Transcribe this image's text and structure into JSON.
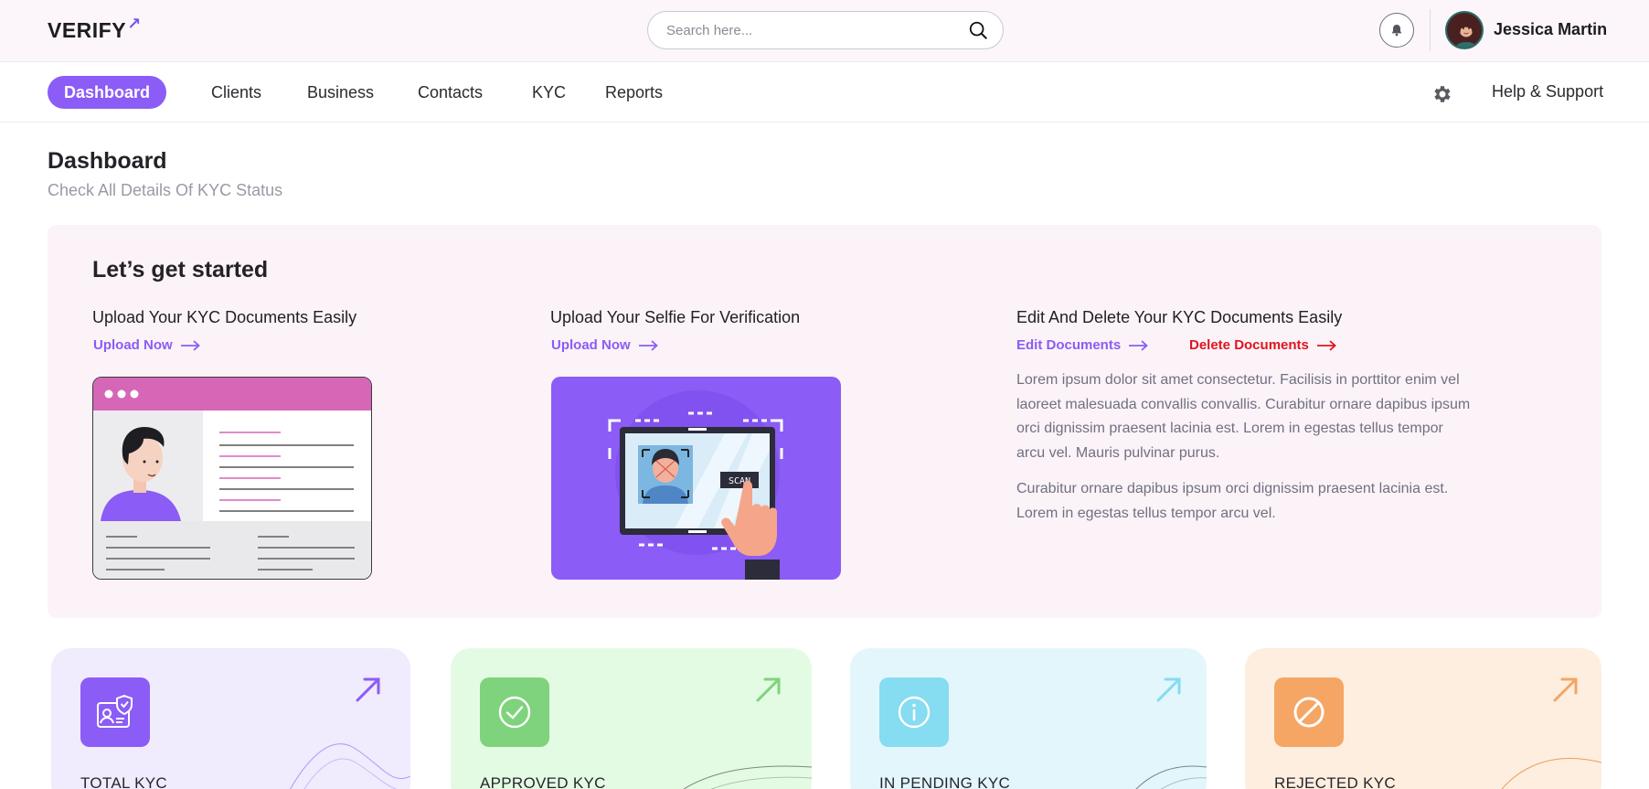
{
  "brand": {
    "logo_text": "VERIFY",
    "logo_mark": "↗"
  },
  "search": {
    "placeholder": "Search here..."
  },
  "user": {
    "name": "Jessica Martin"
  },
  "nav": {
    "items": [
      {
        "label": "Dashboard",
        "active": true
      },
      {
        "label": "Clients"
      },
      {
        "label": "Business"
      },
      {
        "label": "Contacts"
      },
      {
        "label": "KYC"
      },
      {
        "label": "Reports"
      }
    ],
    "help_label": "Help & Support"
  },
  "page": {
    "title": "Dashboard",
    "subtitle": "Check All Details Of KYC Status"
  },
  "get_started": {
    "title": "Let’s get started",
    "col1": {
      "heading": "Upload Your KYC Documents Easily",
      "link": "Upload Now"
    },
    "col2": {
      "heading": "Upload Your Selfie For Verification",
      "link": "Upload Now"
    },
    "col3": {
      "heading": "Edit And Delete Your KYC Documents Easily",
      "edit_link": "Edit Documents",
      "delete_link": "Delete Documents",
      "paragraph1": "Lorem ipsum dolor sit amet consectetur. Facilisis in porttitor enim vel laoreet malesuada convallis convallis. Curabitur ornare dapibus ipsum orci dignissim praesent lacinia est. Lorem in egestas tellus tempor arcu vel. Mauris pulvinar purus.",
      "paragraph2": "Curabitur ornare dapibus ipsum orci dignissim praesent lacinia est. Lorem in egestas tellus tempor arcu vel."
    },
    "scan_button_text": "SCAN"
  },
  "stats": [
    {
      "label": "TOTAL KYC",
      "icon": "id-card-shield-icon",
      "bg": "#f0ebfd",
      "accent": "#8b5cf6"
    },
    {
      "label": "APPROVED KYC",
      "icon": "check-circle-icon",
      "bg": "#e3fbe3",
      "accent": "#7fd37c"
    },
    {
      "label": "IN PENDING KYC",
      "icon": "info-circle-icon",
      "bg": "#e3f6fc",
      "accent": "#86dcf0"
    },
    {
      "label": "REJECTED KYC",
      "icon": "ban-icon",
      "bg": "#fdeedf",
      "accent": "#f5a664"
    }
  ],
  "colors": {
    "accent": "#8b5cf6",
    "danger": "#e0141e",
    "header_bg": "#fcf6fa",
    "panel_bg": "#fcf3f8"
  }
}
